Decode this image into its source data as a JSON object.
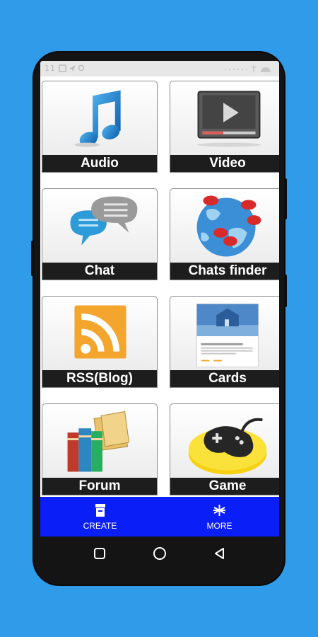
{
  "status_bar": {
    "left": "11",
    "right": ""
  },
  "tiles": [
    {
      "label": "Audio"
    },
    {
      "label": "Video"
    },
    {
      "label": "Chat"
    },
    {
      "label": "Chats finder"
    },
    {
      "label": "RSS(Blog)"
    },
    {
      "label": "Cards"
    },
    {
      "label": "Forum"
    },
    {
      "label": "Game"
    }
  ],
  "cards_preview": {
    "title": "Kangaroo Valley Safari",
    "body": "Located two hours south of Sydney in the Southern Highlands of New South Wales"
  },
  "bottom_nav": {
    "create_label": "CREATE",
    "more_label": "MORE"
  },
  "colors": {
    "background": "#2f9be9",
    "nav_bar": "#0a1ef7",
    "label_bar": "#1d1d1d",
    "rss_orange": "#f3a52e"
  },
  "icons": {
    "audio": "music-note-icon",
    "video": "video-player-icon",
    "chat": "chat-bubbles-icon",
    "chats_finder": "globe-chat-icon",
    "rss": "rss-icon",
    "cards": "card-preview-icon",
    "forum": "books-folders-icon",
    "game": "gamepad-icon",
    "create": "archive-box-icon",
    "more": "asterisk-icon"
  }
}
